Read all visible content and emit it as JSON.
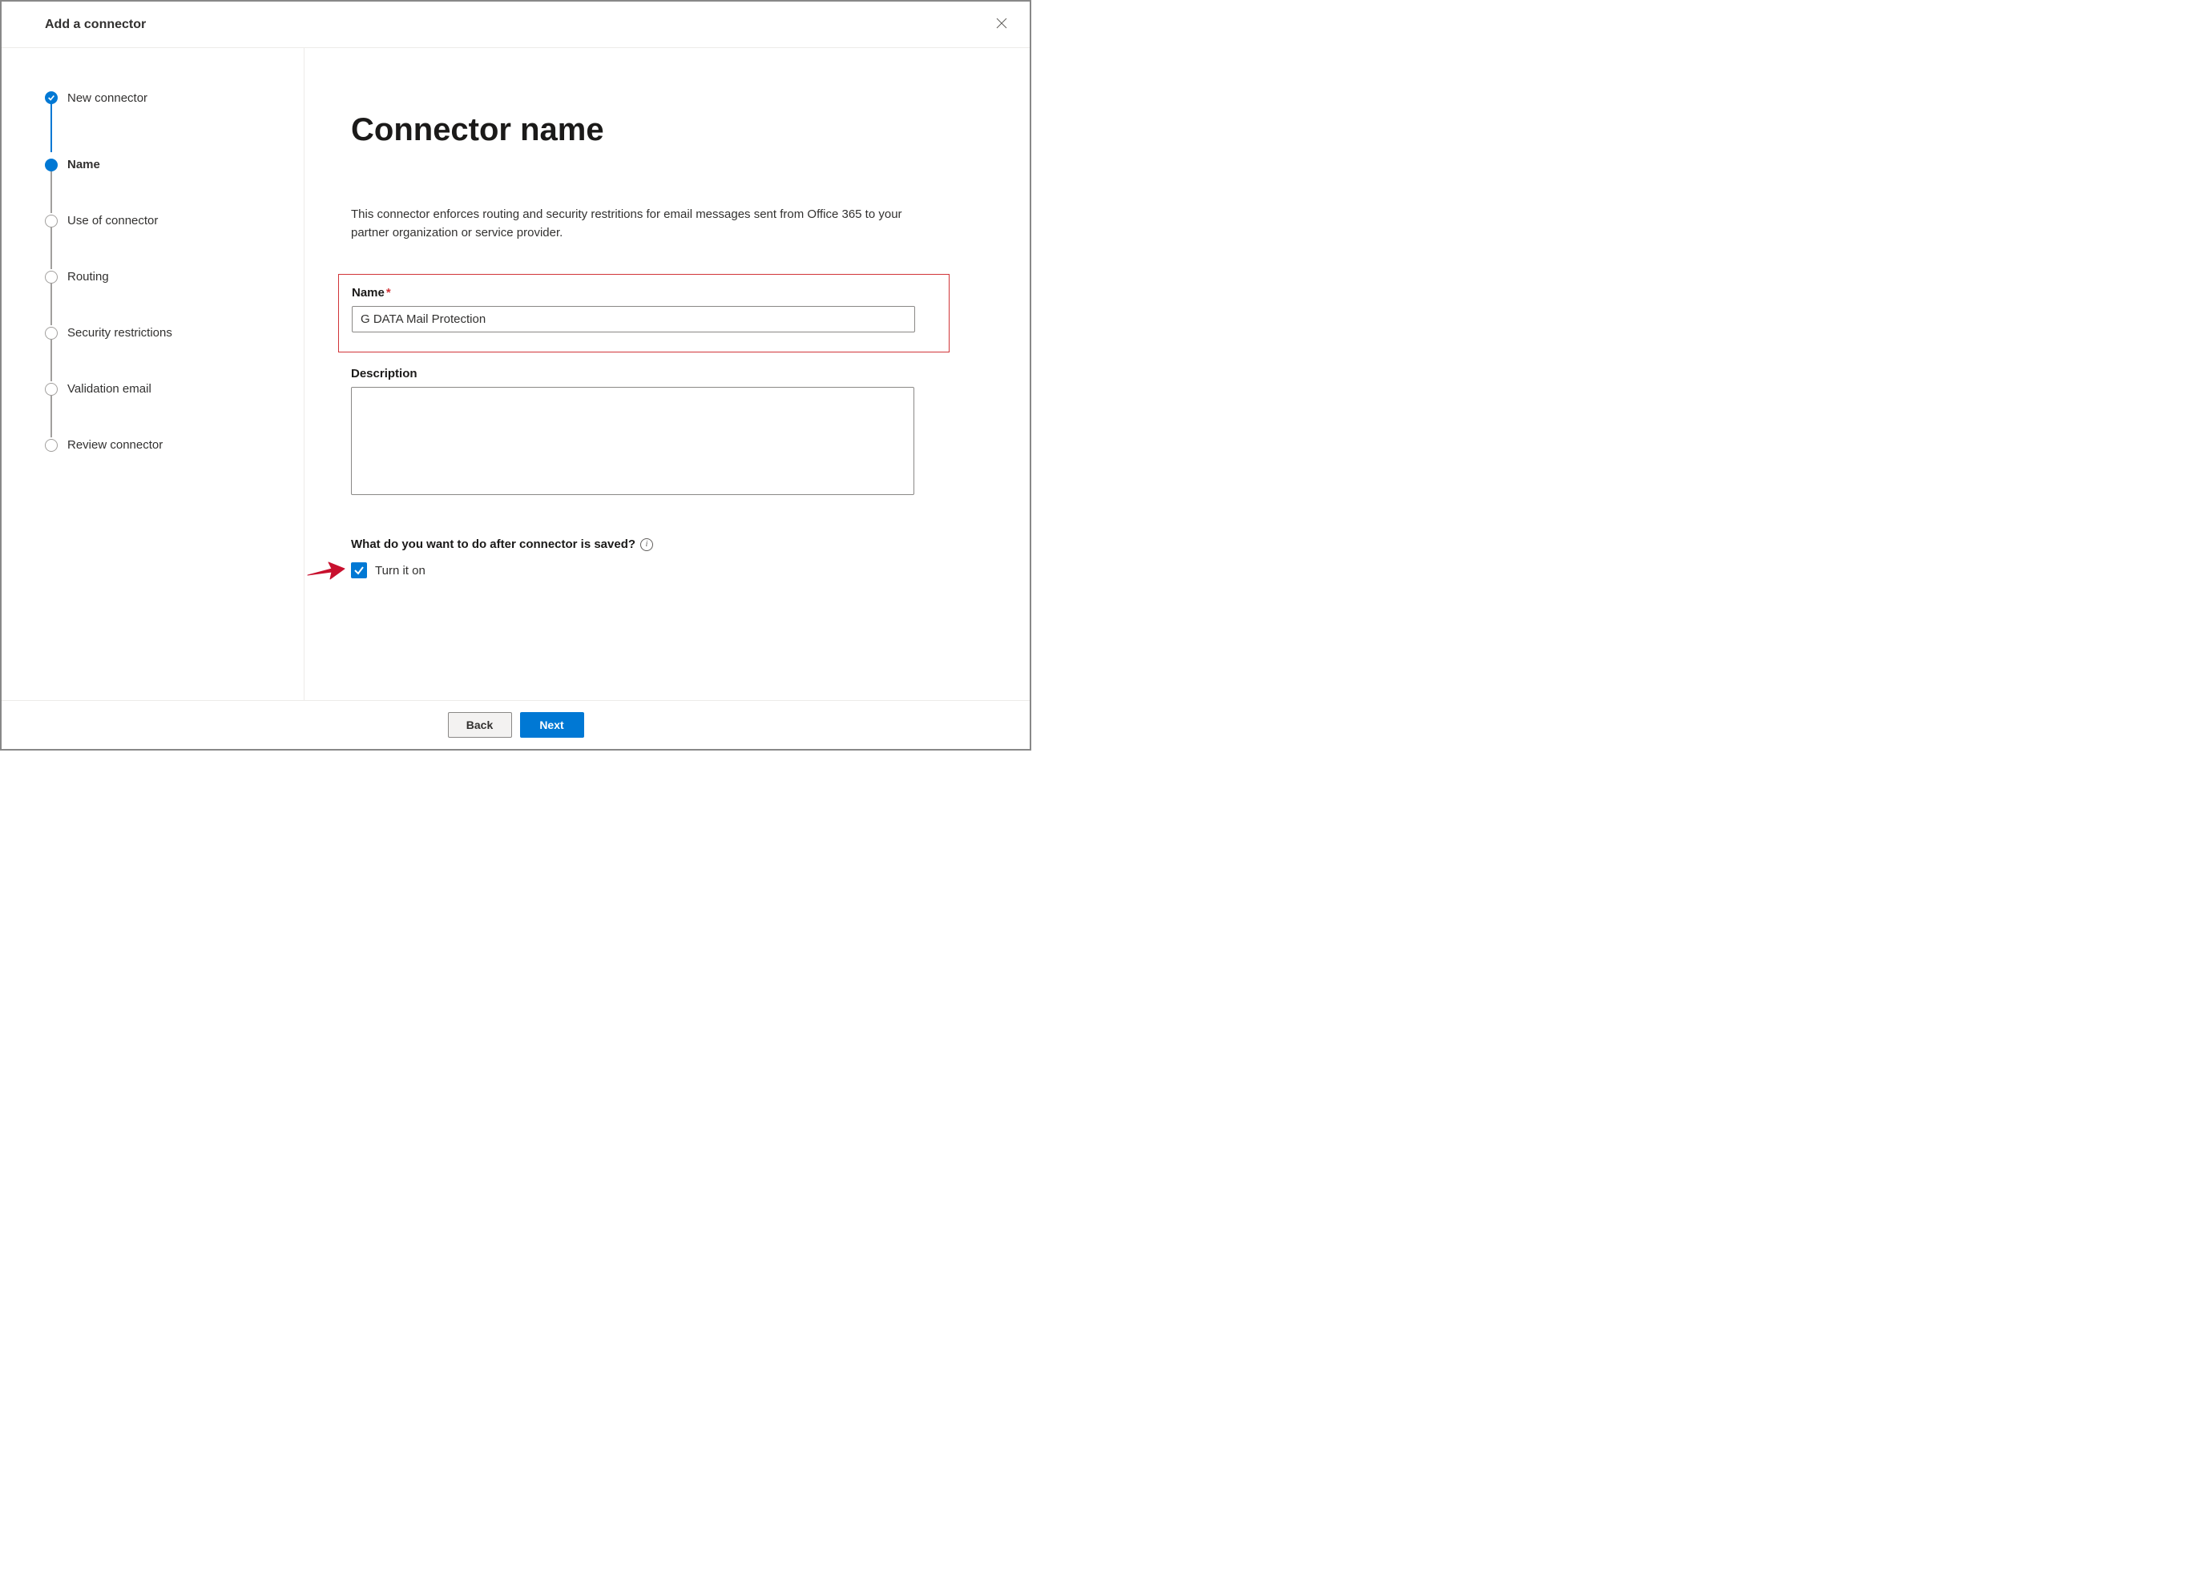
{
  "header": {
    "title": "Add a connector"
  },
  "sidebar": {
    "steps": [
      {
        "label": "New connector",
        "state": "completed"
      },
      {
        "label": "Name",
        "state": "active"
      },
      {
        "label": "Use of connector",
        "state": "pending"
      },
      {
        "label": "Routing",
        "state": "pending"
      },
      {
        "label": "Security restrictions",
        "state": "pending"
      },
      {
        "label": "Validation email",
        "state": "pending"
      },
      {
        "label": "Review connector",
        "state": "pending"
      }
    ]
  },
  "main": {
    "title": "Connector name",
    "description": "This connector enforces routing and security restritions for email messages sent from Office 365 to your partner organization or service provider.",
    "name_label": "Name",
    "name_value": "G DATA Mail Protection",
    "description_label": "Description",
    "description_value": "",
    "question_label": "What do you want to do after connector is saved?",
    "turn_on_label": "Turn it on",
    "turn_on_checked": true
  },
  "footer": {
    "back_label": "Back",
    "next_label": "Next"
  }
}
